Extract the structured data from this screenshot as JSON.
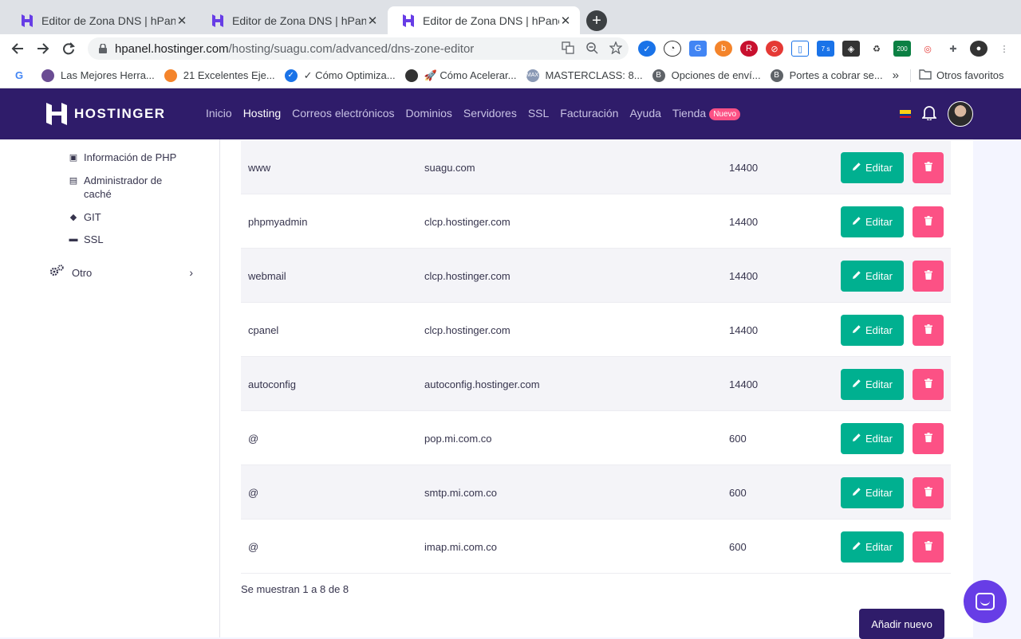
{
  "browser": {
    "tabs": [
      {
        "title": "Editor de Zona DNS | hPanel",
        "active": false
      },
      {
        "title": "Editor de Zona DNS | hPanel",
        "active": false
      },
      {
        "title": "Editor de Zona DNS | hPanel",
        "active": true
      }
    ],
    "url_host": "hpanel.hostinger.com",
    "url_path": "/hosting/suagu.com/advanced/dns-zone-editor",
    "extension_badge": "200",
    "extension_badge_small": "7 s",
    "bookmarks": [
      {
        "label": "Las Mejores Herra...",
        "icon": "bookmark-purple-icon"
      },
      {
        "label": "21 Excelentes Eje...",
        "icon": "bookmark-wordpress-icon"
      },
      {
        "label": "✓ Cómo Optimiza...",
        "icon": "bookmark-check-icon"
      },
      {
        "label": "🚀 Cómo Acelerar...",
        "icon": "bookmark-globe-icon"
      },
      {
        "label": "MASTERCLASS: 8...",
        "icon": "bookmark-max-icon"
      },
      {
        "label": "Opciones de enví...",
        "icon": "bookmark-b-icon"
      },
      {
        "label": "Portes a cobrar se...",
        "icon": "bookmark-b-icon"
      }
    ],
    "bookmarks_overflow": "»",
    "other_bookmarks": "Otros favoritos"
  },
  "header": {
    "brand": "HOSTINGER",
    "nav": [
      {
        "label": "Inicio",
        "active": false
      },
      {
        "label": "Hosting",
        "active": true
      },
      {
        "label": "Correos electrónicos",
        "active": false
      },
      {
        "label": "Dominios",
        "active": false
      },
      {
        "label": "Servidores",
        "active": false
      },
      {
        "label": "SSL",
        "active": false
      },
      {
        "label": "Facturación",
        "active": false
      },
      {
        "label": "Ayuda",
        "active": false
      },
      {
        "label": "Tienda",
        "active": false
      }
    ],
    "new_badge": "Nuevo"
  },
  "sidebar": {
    "items": [
      {
        "label": "Información de PHP",
        "icon": "php-info-icon"
      },
      {
        "label": "Administrador de caché",
        "icon": "cache-icon"
      },
      {
        "label": "GIT",
        "icon": "git-icon"
      },
      {
        "label": "SSL",
        "icon": "ssl-icon"
      }
    ],
    "other": "Otro"
  },
  "dns": {
    "records": [
      {
        "name": "www",
        "target": "suagu.com",
        "ttl": "14400"
      },
      {
        "name": "phpmyadmin",
        "target": "clcp.hostinger.com",
        "ttl": "14400"
      },
      {
        "name": "webmail",
        "target": "clcp.hostinger.com",
        "ttl": "14400"
      },
      {
        "name": "cpanel",
        "target": "clcp.hostinger.com",
        "ttl": "14400"
      },
      {
        "name": "autoconfig",
        "target": "autoconfig.hostinger.com",
        "ttl": "14400"
      },
      {
        "name": "@",
        "target": "pop.mi.com.co",
        "ttl": "600"
      },
      {
        "name": "@",
        "target": "smtp.mi.com.co",
        "ttl": "600"
      },
      {
        "name": "@",
        "target": "imap.mi.com.co",
        "ttl": "600"
      }
    ],
    "edit_label": "Editar",
    "showing": "Se muestran 1 a 8 de 8",
    "add_new": "Añadir nuevo"
  },
  "colors": {
    "header_bg": "#2f1c6a",
    "edit_green": "#00b090",
    "delete_pink": "#fc5185",
    "chat_purple": "#673de6"
  }
}
